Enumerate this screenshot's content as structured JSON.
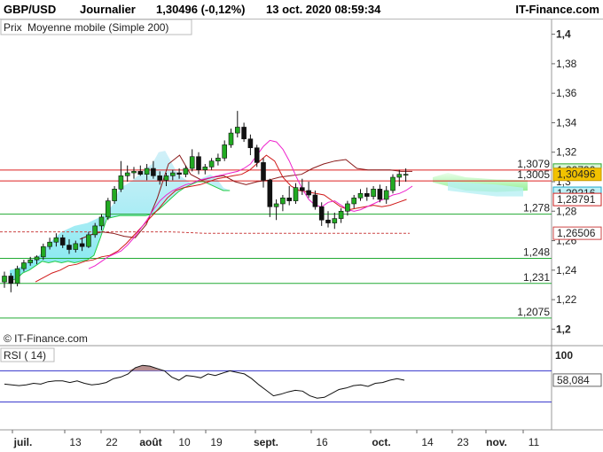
{
  "header": {
    "symbol": "GBP/USD",
    "period": "Journalier",
    "quote": "1,30496 (-0,12%)",
    "datetime": "13 oct. 2020 08:59:34",
    "brand": "IT-Finance.com"
  },
  "legend": {
    "price": "Prix",
    "ma": "Moyenne mobile (Simple 200)"
  },
  "watermark": "© IT-Finance.com",
  "rsi_label": "RSI ( 14)",
  "colors": {
    "up": "#22aa22",
    "down": "#111111",
    "ma_fast": "#ee22cc",
    "ma_mid": "#d01818",
    "ma_slow": "#8a1a1a",
    "ma200": "#cc4444",
    "cloud_bull": "#90ee90",
    "cloud_bear": "#7ae8f0",
    "res_line": "#dd2222",
    "sup_line": "#22aa33",
    "rsi_line": "#111111",
    "rsi_band": "#3333cc",
    "label_current": "#f2c200"
  },
  "chart_data": {
    "type": "candlestick",
    "y_axis": {
      "min": 1.19,
      "max": 1.41,
      "ticks": [
        "1,4",
        "1,38",
        "1,36",
        "1,34",
        "1,32",
        "1,3",
        "1,28",
        "1,26",
        "1,24",
        "1,22",
        "1,2"
      ]
    },
    "x_axis": {
      "labels": [
        "juil.",
        "13",
        "22",
        "août",
        "10",
        "19",
        "sept.",
        "16",
        "oct.",
        "14",
        "23",
        "nov.",
        "11"
      ],
      "bold": [
        "juil.",
        "août",
        "sept.",
        "oct.",
        "nov."
      ]
    },
    "candles": [
      {
        "o": 1.232,
        "h": 1.239,
        "l": 1.228,
        "c": 1.236
      },
      {
        "o": 1.236,
        "h": 1.238,
        "l": 1.225,
        "c": 1.231
      },
      {
        "o": 1.231,
        "h": 1.243,
        "l": 1.229,
        "c": 1.241
      },
      {
        "o": 1.241,
        "h": 1.247,
        "l": 1.239,
        "c": 1.245
      },
      {
        "o": 1.245,
        "h": 1.249,
        "l": 1.243,
        "c": 1.247
      },
      {
        "o": 1.247,
        "h": 1.25,
        "l": 1.244,
        "c": 1.249
      },
      {
        "o": 1.249,
        "h": 1.258,
        "l": 1.247,
        "c": 1.256
      },
      {
        "o": 1.256,
        "h": 1.262,
        "l": 1.254,
        "c": 1.259
      },
      {
        "o": 1.259,
        "h": 1.265,
        "l": 1.256,
        "c": 1.262
      },
      {
        "o": 1.262,
        "h": 1.264,
        "l": 1.255,
        "c": 1.257
      },
      {
        "o": 1.257,
        "h": 1.261,
        "l": 1.251,
        "c": 1.254
      },
      {
        "o": 1.254,
        "h": 1.26,
        "l": 1.252,
        "c": 1.258
      },
      {
        "o": 1.258,
        "h": 1.262,
        "l": 1.253,
        "c": 1.256
      },
      {
        "o": 1.256,
        "h": 1.266,
        "l": 1.255,
        "c": 1.264
      },
      {
        "o": 1.264,
        "h": 1.272,
        "l": 1.262,
        "c": 1.27
      },
      {
        "o": 1.27,
        "h": 1.278,
        "l": 1.267,
        "c": 1.276
      },
      {
        "o": 1.276,
        "h": 1.289,
        "l": 1.274,
        "c": 1.287
      },
      {
        "o": 1.287,
        "h": 1.297,
        "l": 1.285,
        "c": 1.295
      },
      {
        "o": 1.295,
        "h": 1.314,
        "l": 1.293,
        "c": 1.304
      },
      {
        "o": 1.304,
        "h": 1.311,
        "l": 1.3,
        "c": 1.306
      },
      {
        "o": 1.306,
        "h": 1.31,
        "l": 1.302,
        "c": 1.307
      },
      {
        "o": 1.307,
        "h": 1.311,
        "l": 1.304,
        "c": 1.305
      },
      {
        "o": 1.305,
        "h": 1.312,
        "l": 1.301,
        "c": 1.309
      },
      {
        "o": 1.309,
        "h": 1.314,
        "l": 1.302,
        "c": 1.304
      },
      {
        "o": 1.304,
        "h": 1.307,
        "l": 1.298,
        "c": 1.301
      },
      {
        "o": 1.301,
        "h": 1.306,
        "l": 1.297,
        "c": 1.304
      },
      {
        "o": 1.304,
        "h": 1.308,
        "l": 1.301,
        "c": 1.306
      },
      {
        "o": 1.306,
        "h": 1.309,
        "l": 1.302,
        "c": 1.305
      },
      {
        "o": 1.305,
        "h": 1.311,
        "l": 1.303,
        "c": 1.309
      },
      {
        "o": 1.309,
        "h": 1.322,
        "l": 1.307,
        "c": 1.317
      },
      {
        "o": 1.317,
        "h": 1.32,
        "l": 1.305,
        "c": 1.308
      },
      {
        "o": 1.308,
        "h": 1.312,
        "l": 1.305,
        "c": 1.31
      },
      {
        "o": 1.31,
        "h": 1.316,
        "l": 1.308,
        "c": 1.314
      },
      {
        "o": 1.314,
        "h": 1.319,
        "l": 1.311,
        "c": 1.316
      },
      {
        "o": 1.316,
        "h": 1.328,
        "l": 1.314,
        "c": 1.325
      },
      {
        "o": 1.325,
        "h": 1.336,
        "l": 1.323,
        "c": 1.333
      },
      {
        "o": 1.333,
        "h": 1.348,
        "l": 1.33,
        "c": 1.337
      },
      {
        "o": 1.337,
        "h": 1.34,
        "l": 1.327,
        "c": 1.329
      },
      {
        "o": 1.329,
        "h": 1.332,
        "l": 1.318,
        "c": 1.323
      },
      {
        "o": 1.323,
        "h": 1.325,
        "l": 1.31,
        "c": 1.313
      },
      {
        "o": 1.313,
        "h": 1.316,
        "l": 1.296,
        "c": 1.301
      },
      {
        "o": 1.301,
        "h": 1.302,
        "l": 1.276,
        "c": 1.283
      },
      {
        "o": 1.283,
        "h": 1.288,
        "l": 1.274,
        "c": 1.285
      },
      {
        "o": 1.285,
        "h": 1.291,
        "l": 1.28,
        "c": 1.289
      },
      {
        "o": 1.289,
        "h": 1.297,
        "l": 1.284,
        "c": 1.287
      },
      {
        "o": 1.287,
        "h": 1.299,
        "l": 1.285,
        "c": 1.296
      },
      {
        "o": 1.296,
        "h": 1.302,
        "l": 1.291,
        "c": 1.294
      },
      {
        "o": 1.294,
        "h": 1.3,
        "l": 1.289,
        "c": 1.291
      },
      {
        "o": 1.291,
        "h": 1.294,
        "l": 1.281,
        "c": 1.283
      },
      {
        "o": 1.283,
        "h": 1.286,
        "l": 1.27,
        "c": 1.274
      },
      {
        "o": 1.274,
        "h": 1.28,
        "l": 1.269,
        "c": 1.272
      },
      {
        "o": 1.272,
        "h": 1.279,
        "l": 1.268,
        "c": 1.275
      },
      {
        "o": 1.275,
        "h": 1.282,
        "l": 1.272,
        "c": 1.28
      },
      {
        "o": 1.28,
        "h": 1.287,
        "l": 1.277,
        "c": 1.285
      },
      {
        "o": 1.285,
        "h": 1.291,
        "l": 1.282,
        "c": 1.289
      },
      {
        "o": 1.289,
        "h": 1.295,
        "l": 1.287,
        "c": 1.292
      },
      {
        "o": 1.292,
        "h": 1.296,
        "l": 1.287,
        "c": 1.29
      },
      {
        "o": 1.29,
        "h": 1.297,
        "l": 1.288,
        "c": 1.295
      },
      {
        "o": 1.295,
        "h": 1.298,
        "l": 1.286,
        "c": 1.288
      },
      {
        "o": 1.288,
        "h": 1.297,
        "l": 1.285,
        "c": 1.294
      },
      {
        "o": 1.294,
        "h": 1.305,
        "l": 1.292,
        "c": 1.303
      },
      {
        "o": 1.303,
        "h": 1.308,
        "l": 1.297,
        "c": 1.305
      },
      {
        "o": 1.305,
        "h": 1.309,
        "l": 1.3,
        "c": 1.305
      }
    ],
    "ma_fast": [
      1.241,
      1.243,
      1.246,
      1.249,
      1.251,
      1.253,
      1.257,
      1.262,
      1.268,
      1.274,
      1.281,
      1.287,
      1.291,
      1.294,
      1.296,
      1.298,
      1.299,
      1.301,
      1.302,
      1.303,
      1.304,
      1.305,
      1.306,
      1.307,
      1.309,
      1.312,
      1.318,
      1.324,
      1.328,
      1.327,
      1.322,
      1.314,
      1.304,
      1.295,
      1.288,
      1.284,
      1.283,
      1.286,
      1.287,
      1.284,
      1.281,
      1.28,
      1.281,
      1.283,
      1.285,
      1.287,
      1.289,
      1.291,
      1.292,
      1.294,
      1.297
    ],
    "ma_mid": [
      1.232,
      1.235,
      1.238,
      1.24,
      1.243,
      1.244,
      1.246,
      1.247,
      1.249,
      1.25,
      1.253,
      1.258,
      1.264,
      1.27,
      1.276,
      1.282,
      1.289,
      1.294,
      1.296,
      1.297,
      1.298,
      1.3,
      1.302,
      1.303,
      1.304,
      1.305,
      1.308,
      1.313,
      1.318,
      1.314,
      1.303,
      1.297,
      1.294,
      1.293,
      1.292,
      1.291,
      1.287,
      1.283,
      1.281,
      1.282,
      1.283,
      1.284,
      1.283,
      1.284,
      1.286,
      1.288
    ],
    "ma_slow": [
      1.261,
      1.264,
      1.266,
      1.265,
      1.263,
      1.262,
      1.271,
      1.289,
      1.312,
      1.318,
      1.305,
      1.301,
      1.303,
      1.304,
      1.3,
      1.298,
      1.3,
      1.301,
      1.303,
      1.304,
      1.305,
      1.309,
      1.312,
      1.314,
      1.315,
      1.309,
      1.308,
      1.308,
      1.308,
      1.307,
      1.307
    ],
    "ma200": [
      1.266,
      1.266,
      1.266,
      1.266,
      1.266,
      1.266,
      1.265,
      1.265,
      1.265,
      1.265,
      1.265,
      1.265,
      1.265
    ],
    "cloud_top": [
      1.24,
      1.241,
      1.243,
      1.246,
      1.248,
      1.252,
      1.258,
      1.262,
      1.266,
      1.268,
      1.27,
      1.271,
      1.272,
      1.274,
      1.276,
      1.279,
      1.285,
      1.296,
      1.298,
      1.301,
      1.305,
      1.309,
      1.312,
      1.32,
      1.321,
      1.313,
      1.305,
      1.302,
      1.299,
      1.301,
      1.303,
      1.305,
      1.302,
      1.296,
      1.294
    ],
    "cloud_bottom": [
      1.233,
      1.234,
      1.238,
      1.24,
      1.243,
      1.246,
      1.245,
      1.246,
      1.245,
      1.246,
      1.245,
      1.246,
      1.247,
      1.25,
      1.262,
      1.275,
      1.276,
      1.277,
      1.277,
      1.277,
      1.277,
      1.277,
      1.278,
      1.281,
      1.285,
      1.289,
      1.293,
      1.296,
      1.298,
      1.3,
      1.3,
      1.298,
      1.296,
      1.294,
      1.294
    ],
    "resistance_levels": [
      1.3079,
      1.3005
    ],
    "support_levels": [
      1.278,
      1.248,
      1.231,
      1.2075
    ],
    "left_labels": [
      "1,3079",
      "1,3005",
      "1,278",
      "1,248",
      "1,231",
      "1,2075"
    ],
    "right_labels": [
      "1,30790",
      "1,30496",
      "1,29216",
      "1,28791",
      "1,26506"
    ],
    "rsi": {
      "value": 58.084,
      "value_label": "58,084",
      "scale_top_label": "100",
      "band_upper": 70,
      "band_lower": 30,
      "values": [
        53,
        52,
        51,
        52,
        54,
        53,
        56,
        57,
        57,
        55,
        57,
        54,
        52,
        53,
        55,
        60,
        62,
        66,
        74,
        77,
        76,
        73,
        70,
        62,
        58,
        64,
        63,
        61,
        66,
        64,
        67,
        70,
        68,
        66,
        60,
        52,
        45,
        38,
        40,
        43,
        45,
        44,
        38,
        35,
        36,
        41,
        46,
        48,
        51,
        52,
        50,
        54,
        55,
        58,
        60,
        58
      ]
    }
  }
}
